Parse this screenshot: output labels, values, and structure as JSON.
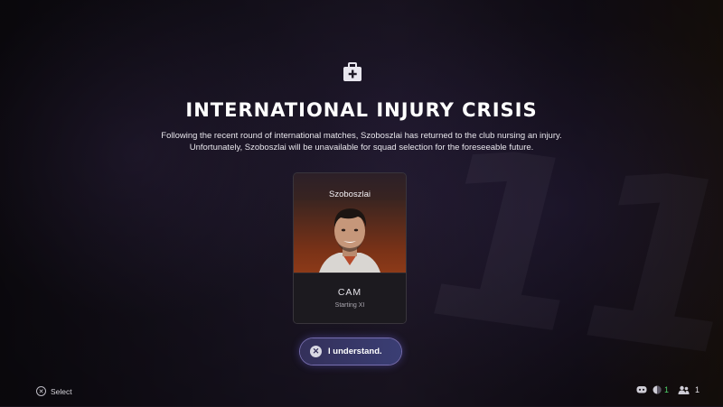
{
  "header": {
    "icon": "medkit-icon",
    "title": "INTERNATIONAL INJURY CRISIS",
    "description_line1": "Following the recent round of international matches, Szoboszlai has returned to the club nursing an injury.",
    "description_line2": "Unfortunately, Szoboszlai will be unavailable for squad selection for the foreseeable future."
  },
  "player_card": {
    "name": "Szoboszlai",
    "position": "CAM",
    "status": "Starting XI"
  },
  "confirm_button": {
    "icon": "cross-button-icon",
    "label": "I understand."
  },
  "footer": {
    "select_icon": "cross-button-icon",
    "select_label": "Select",
    "indicators": [
      {
        "icon": "controller-icon",
        "value": ""
      },
      {
        "icon": "ball-icon",
        "value": "1"
      },
      {
        "icon": "players-icon",
        "value": "1"
      }
    ]
  },
  "colors": {
    "accent": "#3a3e74",
    "online_green": "#4ed36b"
  }
}
